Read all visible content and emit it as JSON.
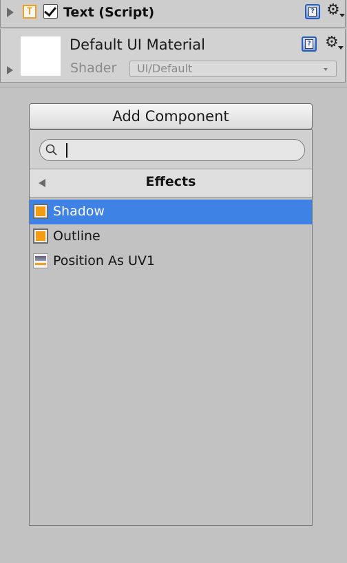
{
  "component": {
    "title": "Text (Script)",
    "icon_letter": "T",
    "enabled": true
  },
  "material": {
    "name": "Default UI Material",
    "shader_label": "Shader",
    "shader_value": "UI/Default"
  },
  "add_component": {
    "button_label": "Add Component",
    "search": {
      "value": "",
      "placeholder": ""
    },
    "category_title": "Effects",
    "items": [
      {
        "label": "Shadow",
        "icon": "shadow-script-icon",
        "selected": true
      },
      {
        "label": "Outline",
        "icon": "outline-script-icon",
        "selected": false
      },
      {
        "label": "Position As UV1",
        "icon": "position-as-uv1-icon",
        "selected": false
      }
    ]
  },
  "colors": {
    "panel_bg": "#c2c2c2",
    "selection": "#3f82e6",
    "script_icon_orange": "#f39c12",
    "help_icon_blue": "#2b5db8"
  }
}
